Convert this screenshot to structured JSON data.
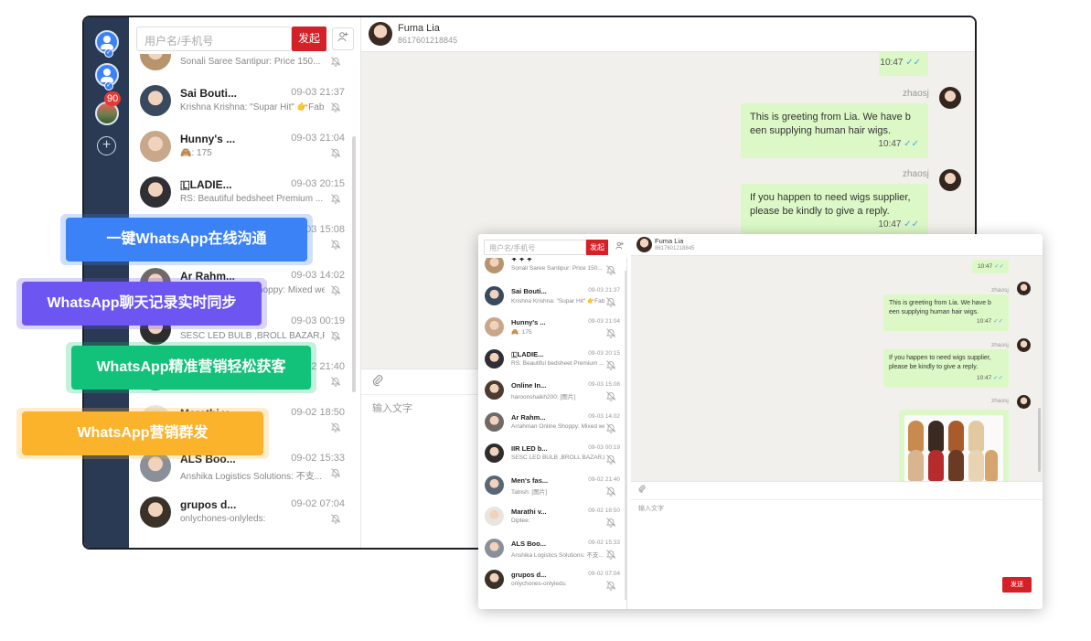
{
  "colors": {
    "accent_red": "#d42027",
    "rail_bg": "#2a3a55",
    "bubble_green": "#dcf8c6",
    "chat_bg": "#f2f0ec",
    "tick_blue": "#4fa3e0",
    "badge_red": "#e53935"
  },
  "rail": {
    "badge": "90",
    "add_symbol": "+"
  },
  "search": {
    "placeholder": "用户名/手机号",
    "start_label": "发起",
    "add_icon": "person-add-icon"
  },
  "contacts": [
    {
      "name": "✦ ✦ ✦",
      "time": "",
      "preview": "Sonali Saree Santipur: Price 150...",
      "avatar_color": "#b8946e"
    },
    {
      "name": "Sai Bouti...",
      "time": "09-03 21:37",
      "preview": "Krishna Krishna: \"Supar Hit\" 👉Fab...",
      "avatar_color": "#394a5e"
    },
    {
      "name": "Hunny's ...",
      "time": "09-03 21:04",
      "preview": "🙈: 175",
      "avatar_color": "#c9a78a"
    },
    {
      "name": "🇱LADIE...",
      "time": "09-03 20:15",
      "preview": "RS: Beautiful bedsheet Premium ...",
      "avatar_color": "#2f2f35"
    },
    {
      "name": "Online In...",
      "time": "09-03 15:08",
      "preview": "haroonshaikh200: [图片]",
      "avatar_color": "#4d3a30"
    },
    {
      "name": "Ar Rahm...",
      "time": "09-03 14:02",
      "preview": "Arrahman Online Shoppy: Mixed we...",
      "avatar_color": "#6f6a66"
    },
    {
      "name": "IIR LED b...",
      "time": "09-03 00:19",
      "preview": "SESC LED BULB ,BROLL BAZAR,P...",
      "avatar_color": "#2d2d2d"
    },
    {
      "name": "Men's fas...",
      "time": "09-02 21:40",
      "preview": "Tabish: [图片]",
      "avatar_color": "#5b6675"
    },
    {
      "name": "Marathi v...",
      "time": "09-02 18:50",
      "preview": "Diptee:",
      "avatar_color": "#e8e4df"
    },
    {
      "name": "ALS Boo...",
      "time": "09-02 15:33",
      "preview": "Anshika Logistics Solutions: 不支...",
      "avatar_color": "#8a8f99"
    },
    {
      "name": "grupos d...",
      "time": "09-02 07:04",
      "preview": "onlychones-onlyleds:",
      "avatar_color": "#3a3128"
    }
  ],
  "chat": {
    "name": "Fuma Lia",
    "phone": "8617601218845",
    "sender": "zhaosj",
    "messages": [
      {
        "text": "",
        "time": "10:47"
      },
      {
        "text": "This is greeting from Lia. We have b een supplying human hair wigs.",
        "time": "10:47"
      },
      {
        "text": "If you happen to need wigs supplier, please be kindly to give a reply.",
        "time": "10:47"
      }
    ],
    "input_placeholder": "输入文字",
    "send_label": "发送",
    "attach_icon": "paperclip-icon"
  },
  "features": [
    {
      "label": "一键WhatsApp在线沟通",
      "color": "#3b82f6"
    },
    {
      "label": "WhatsApp聊天记录实时同步",
      "color": "#6d55f2"
    },
    {
      "label": "WhatsApp精准营销轻松获客",
      "color": "#12c27a"
    },
    {
      "label": "WhatsApp营销群发",
      "color": "#fbb32c"
    }
  ]
}
